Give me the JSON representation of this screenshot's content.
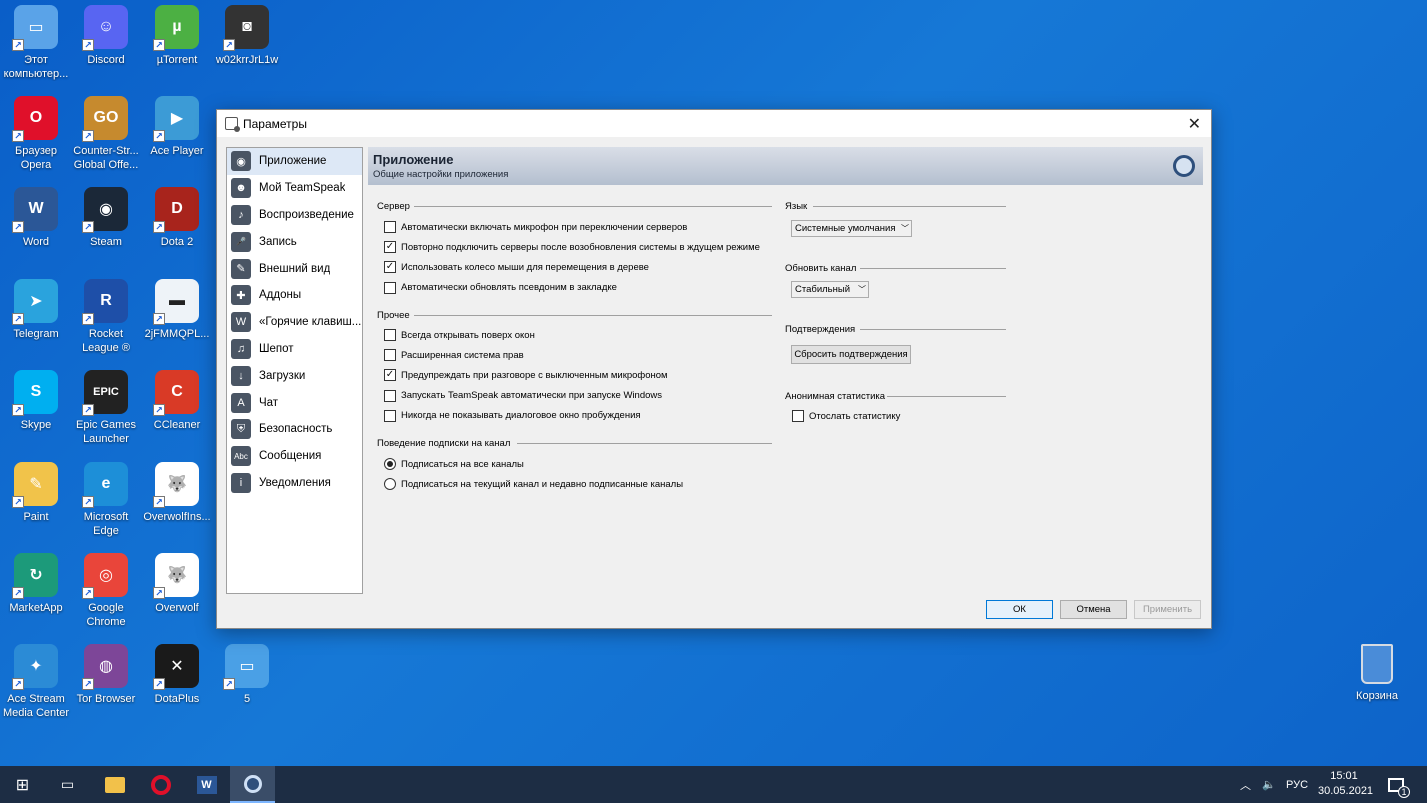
{
  "desktop": {
    "icons": [
      {
        "label": "Этот\nкомпьютер...",
        "name": "this-pc-icon",
        "color": "#5aa3e8",
        "glyph": "▭"
      },
      {
        "label": "Discord",
        "name": "discord-icon",
        "color": "#5865f2",
        "glyph": "☺"
      },
      {
        "label": "µTorrent",
        "name": "utorrent-icon",
        "color": "#4cb043",
        "glyph": "µ"
      },
      {
        "label": "w02krrJrL1w",
        "name": "photo-file-icon",
        "color": "#333333",
        "glyph": "◙"
      },
      {
        "label": "Браузер\nOpera",
        "name": "opera-icon",
        "color": "#e0102a",
        "glyph": "O"
      },
      {
        "label": "Counter-Str...\nGlobal Offe...",
        "name": "csgo-icon",
        "color": "#c68a2e",
        "glyph": "GO"
      },
      {
        "label": "Ace Player",
        "name": "ace-player-icon",
        "color": "#3c9bd6",
        "glyph": "▶"
      },
      {
        "label": "Word",
        "name": "word-icon",
        "color": "#2b5797",
        "glyph": "W"
      },
      {
        "label": "Steam",
        "name": "steam-icon",
        "color": "#1b2838",
        "glyph": "◉"
      },
      {
        "label": "Dota 2",
        "name": "dota2-icon",
        "color": "#a8241c",
        "glyph": "D"
      },
      {
        "label": "Telegram",
        "name": "telegram-icon",
        "color": "#2aa3dd",
        "glyph": "➤"
      },
      {
        "label": "Rocket\nLeague ®",
        "name": "rocket-league-icon",
        "color": "#1e4fa8",
        "glyph": "R"
      },
      {
        "label": "2jFMMQPL...",
        "name": "image-file-icon",
        "color": "#eef3f8",
        "glyph": "▬"
      },
      {
        "label": "Skype",
        "name": "skype-icon",
        "color": "#00aff0",
        "glyph": "S"
      },
      {
        "label": "Epic Games\nLauncher",
        "name": "epic-games-icon",
        "color": "#222222",
        "glyph": "EPIC"
      },
      {
        "label": "CCleaner",
        "name": "ccleaner-icon",
        "color": "#d93a26",
        "glyph": "C"
      },
      {
        "label": "Paint",
        "name": "paint-icon",
        "color": "#f1c34a",
        "glyph": "✎"
      },
      {
        "label": "Microsoft\nEdge",
        "name": "edge-icon",
        "color": "#1d8fd8",
        "glyph": "e"
      },
      {
        "label": "OverwolfIns...",
        "name": "overwolf-installer-icon",
        "color": "#ffffff",
        "glyph": "🐺"
      },
      {
        "label": "MarketApp",
        "name": "marketapp-icon",
        "color": "#1c9a7a",
        "glyph": "↻"
      },
      {
        "label": "Google\nChrome",
        "name": "chrome-icon",
        "color": "#e9453a",
        "glyph": "◎"
      },
      {
        "label": "Overwolf",
        "name": "overwolf-icon",
        "color": "#ffffff",
        "glyph": "🐺"
      },
      {
        "label": "Ace Stream\nMedia Center",
        "name": "ace-stream-icon",
        "color": "#2b8bd6",
        "glyph": "✦"
      },
      {
        "label": "Tor Browser",
        "name": "tor-browser-icon",
        "color": "#7d4698",
        "glyph": "◍"
      },
      {
        "label": "DotaPlus",
        "name": "dotaplus-icon",
        "color": "#1a1a1a",
        "glyph": "✕"
      },
      {
        "label": "5",
        "name": "file-5-icon",
        "color": "#4aa0e6",
        "glyph": "▭"
      }
    ],
    "recycle_bin": "Корзина"
  },
  "dialog": {
    "title": "Параметры",
    "nav": [
      {
        "label": "Приложение",
        "name": "nav-application",
        "icon": "teamspeak-icon",
        "glyph": "◉",
        "active": true
      },
      {
        "label": "Мой TeamSpeak",
        "name": "nav-my-teamspeak",
        "icon": "user-icon",
        "glyph": "☻",
        "active": false
      },
      {
        "label": "Воспроизведение",
        "name": "nav-playback",
        "icon": "speaker-icon",
        "glyph": "♪",
        "active": false
      },
      {
        "label": "Запись",
        "name": "nav-capture",
        "icon": "microphone-icon",
        "glyph": "🎤",
        "active": false
      },
      {
        "label": "Внешний вид",
        "name": "nav-design",
        "icon": "brush-icon",
        "glyph": "✎",
        "active": false
      },
      {
        "label": "Аддоны",
        "name": "nav-addons",
        "icon": "puzzle-icon",
        "glyph": "✚",
        "active": false
      },
      {
        "label": "«Горячие клавиш...",
        "name": "nav-hotkeys",
        "icon": "keyboard-icon",
        "glyph": "W",
        "active": false
      },
      {
        "label": "Шепот",
        "name": "nav-whisper",
        "icon": "whisper-icon",
        "glyph": "♫",
        "active": false
      },
      {
        "label": "Загрузки",
        "name": "nav-downloads",
        "icon": "download-icon",
        "glyph": "↓",
        "active": false
      },
      {
        "label": "Чат",
        "name": "nav-chat",
        "icon": "chat-icon",
        "glyph": "A",
        "active": false
      },
      {
        "label": "Безопасность",
        "name": "nav-security",
        "icon": "shield-icon",
        "glyph": "⛨",
        "active": false
      },
      {
        "label": "Сообщения",
        "name": "nav-messages",
        "icon": "abc-icon",
        "glyph": "Abc",
        "active": false
      },
      {
        "label": "Уведомления",
        "name": "nav-notifications",
        "icon": "info-icon",
        "glyph": "i",
        "active": false
      }
    ],
    "header": {
      "title": "Приложение",
      "subtitle": "Общие настройки приложения"
    },
    "server_group": {
      "label": "Сервер",
      "options": [
        {
          "label": "Автоматически включать микрофон при переключении серверов",
          "checked": false
        },
        {
          "label": "Повторно подключить серверы после возобновления системы в ждущем режиме",
          "checked": true
        },
        {
          "label": "Использовать колесо мыши для перемещения в дереве",
          "checked": true
        },
        {
          "label": "Автоматически обновлять псевдоним в закладке",
          "checked": false
        }
      ]
    },
    "misc_group": {
      "label": "Прочее",
      "options": [
        {
          "label": "Всегда открывать поверх окон",
          "checked": false
        },
        {
          "label": "Расширенная система прав",
          "checked": false
        },
        {
          "label": "Предупреждать при разговоре с выключенным микрофоном",
          "checked": true
        },
        {
          "label": "Запускать TeamSpeak автоматически при запуске Windows",
          "checked": false
        },
        {
          "label": "Никогда не показывать диалоговое окно пробуждения",
          "checked": false
        }
      ]
    },
    "subscribe_group": {
      "label": "Поведение подписки на канал",
      "options": [
        {
          "label": "Подписаться на все каналы",
          "selected": true
        },
        {
          "label": "Подписаться на текущий канал и недавно подписанные каналы",
          "selected": false
        }
      ]
    },
    "language_group": {
      "label": "Язык",
      "value": "Системные умолчания"
    },
    "update_group": {
      "label": "Обновить канал",
      "value": "Стабильный"
    },
    "confirm_group": {
      "label": "Подтверждения",
      "button": "Сбросить подтверждения"
    },
    "stats_group": {
      "label": "Анонимная статистика",
      "option": "Отослать статистику",
      "checked": false
    },
    "buttons": {
      "ok": "ОК",
      "cancel": "Отмена",
      "apply": "Применить"
    }
  },
  "taskbar": {
    "language": "РУС",
    "time": "15:01",
    "date": "30.05.2021",
    "notification_count": "1"
  }
}
